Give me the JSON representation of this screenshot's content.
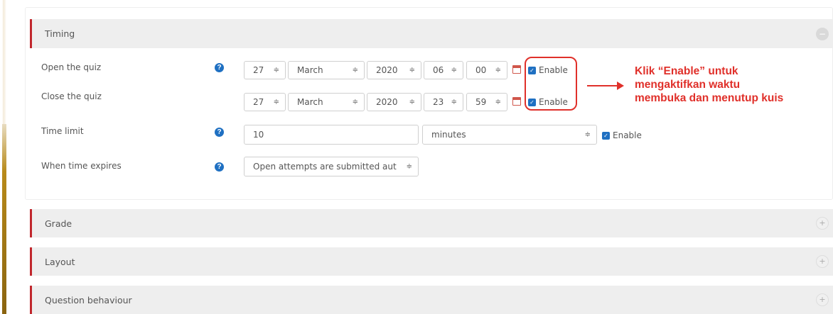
{
  "sections": {
    "timing": {
      "title": "Timing",
      "toggle": "−"
    },
    "grade": {
      "title": "Grade",
      "toggle": "+"
    },
    "layout": {
      "title": "Layout",
      "toggle": "+"
    },
    "question_behaviour": {
      "title": "Question behaviour",
      "toggle": "+"
    }
  },
  "help_icon": "?",
  "select_arrow": "≑",
  "check_mark": "✓",
  "open_quiz": {
    "label": "Open the quiz",
    "day": "27",
    "month": "March",
    "year": "2020",
    "hour": "06",
    "minute": "00",
    "enable_label": "Enable"
  },
  "close_quiz": {
    "label": "Close the quiz",
    "day": "27",
    "month": "March",
    "year": "2020",
    "hour": "23",
    "minute": "59",
    "enable_label": "Enable"
  },
  "time_limit": {
    "label": "Time limit",
    "value": "10",
    "unit": "minutes",
    "enable_label": "Enable"
  },
  "when_expires": {
    "label": "When time expires",
    "value": "Open attempts are submitted aut"
  },
  "annotation": {
    "line1": "Klik “Enable” untuk",
    "line2": "mengaktifkan waktu",
    "line3": "membuka dan menutup kuis",
    "color": "#e0302a"
  },
  "colors": {
    "accent_border": "#c1272d",
    "checkbox": "#1f70c2",
    "help_icon": "#1f70c2",
    "calendar": "#d0564b"
  }
}
